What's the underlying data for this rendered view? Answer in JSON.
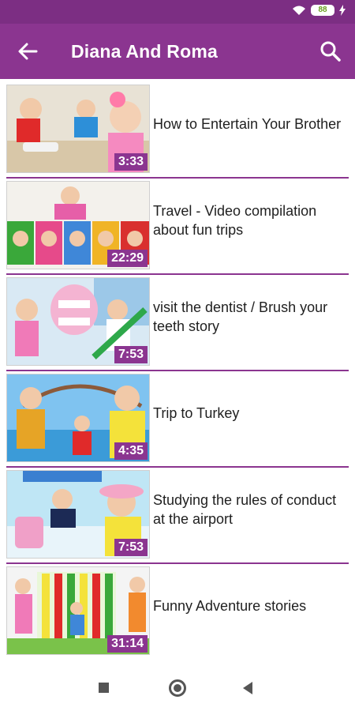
{
  "status_bar": {
    "battery": "88"
  },
  "app_bar": {
    "title": "Diana And Roma"
  },
  "videos": [
    {
      "title": "How to Entertain Your Brother",
      "duration": "3:33"
    },
    {
      "title": "Travel - Video compilation about fun trips",
      "duration": "22:29"
    },
    {
      "title": "visit the dentist / Brush your teeth story",
      "duration": "7:53"
    },
    {
      "title": "Trip to Turkey",
      "duration": "4:35"
    },
    {
      "title": "Studying the rules of conduct at the airport",
      "duration": "7:53"
    },
    {
      "title": "Funny  Adventure stories",
      "duration": "31:14"
    }
  ],
  "colors": {
    "accent": "#8b3590",
    "status_bar": "#7c2e83",
    "battery_text": "#6a9d1f"
  },
  "icons": {
    "back": "arrow-left-icon",
    "search": "search-icon",
    "wifi": "wifi-icon",
    "battery": "battery-icon"
  }
}
